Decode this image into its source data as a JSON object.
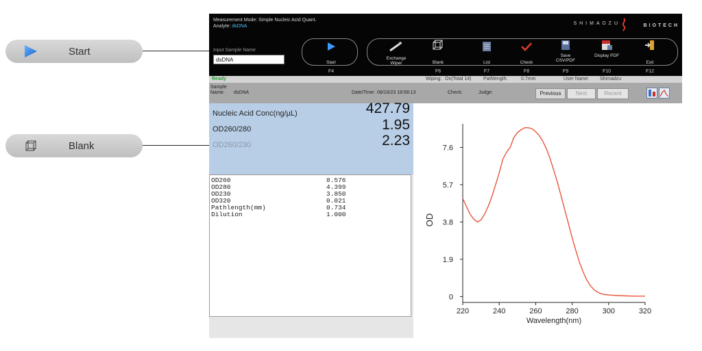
{
  "callouts": [
    {
      "label": "Start",
      "icon": "play-icon"
    },
    {
      "label": "Blank",
      "icon": "cube-outline-icon"
    }
  ],
  "header": {
    "mode_label": "Measurement Mode:",
    "mode_value": "Simple Nucleic Acid Quant.",
    "analyte_label": "Analyte:",
    "analyte_value": "dsDNA",
    "brand": "SHIMADZU",
    "brand_sub": "BIOTECH"
  },
  "sample_input": {
    "label": "Input Sample Name",
    "value": "dsDNA"
  },
  "toolbar": [
    {
      "label": "Start",
      "key": "F4",
      "icon": "play-icon"
    },
    {
      "label": "Exchange Wiper",
      "key": "",
      "icon": "wiper-icon"
    },
    {
      "label": "Blank",
      "key": "F6",
      "icon": "cube-outline-icon"
    },
    {
      "label": "List",
      "key": "F7",
      "icon": "list-icon"
    },
    {
      "label": "Check",
      "key": "F8",
      "icon": "checkmark-icon"
    },
    {
      "label": "Save CSV/PDF",
      "key": "F9",
      "icon": "save-icon"
    },
    {
      "label": "Display PDF",
      "key": "F10",
      "icon": "pdf-icon"
    },
    {
      "label": "Exit",
      "key": "F12",
      "icon": "exit-icon"
    }
  ],
  "status": {
    "state": "Ready",
    "wiping_label": "Wiping:",
    "wiping_value": "On(Total 14)",
    "pathlength_label": "Pathlength:",
    "pathlength_value": "0.7mm",
    "user_label": "User Name:",
    "user_value": "Shimadzu"
  },
  "info": {
    "sample_label": "Sample Name:",
    "sample_value": "dsDNA",
    "datetime_label": "Date/Time:",
    "datetime_value": "08/10/23 18:58:13",
    "check_label": "Check:",
    "judge_label": "Judge:",
    "previous": "Previous",
    "next": "Next",
    "recent": "Recent"
  },
  "results": [
    {
      "label": "Nucleic Acid Conc(ng/µL)",
      "value": "427.79"
    },
    {
      "label": "OD260/280",
      "value": "1.95"
    },
    {
      "label": "OD260/230",
      "value": "2.23"
    }
  ],
  "details": [
    {
      "label": "OD260",
      "value": "8.576"
    },
    {
      "label": "OD280",
      "value": "4.399"
    },
    {
      "label": "OD230",
      "value": "3.850"
    },
    {
      "label": "OD320",
      "value": "0.021"
    },
    {
      "label": "Pathlength(mm)",
      "value": "0.734"
    },
    {
      "label": "Dilution",
      "value": "1.000"
    }
  ],
  "colors": {
    "accent_red": "#e03a2a",
    "result_bg": "#b8cee6",
    "curve": "#e8553a"
  },
  "chart_data": {
    "type": "line",
    "xlabel": "Wavelength(nm)",
    "ylabel": "OD",
    "xlim": [
      220,
      320
    ],
    "ylim": [
      -0.3,
      8.8
    ],
    "xticks": [
      220,
      240,
      260,
      280,
      300,
      320
    ],
    "yticks": [
      "0",
      "1.9",
      "3.8",
      "5.7",
      "7.6"
    ],
    "ytick_values": [
      0,
      1.9,
      3.8,
      5.7,
      7.6
    ],
    "series": [
      {
        "x": [
          220,
          222,
          224,
          226,
          228,
          230,
          232,
          234,
          236,
          238,
          240,
          242,
          244,
          246,
          248,
          250,
          252,
          254,
          256,
          258,
          260,
          262,
          264,
          266,
          268,
          270,
          272,
          274,
          276,
          278,
          280,
          282,
          284,
          286,
          288,
          290,
          292,
          294,
          296,
          298,
          300,
          305,
          310,
          315,
          320
        ],
        "y": [
          5.0,
          4.6,
          4.2,
          3.95,
          3.8,
          3.9,
          4.2,
          4.6,
          5.1,
          5.7,
          6.3,
          7.0,
          7.35,
          7.6,
          8.1,
          8.35,
          8.5,
          8.6,
          8.6,
          8.55,
          8.4,
          8.2,
          7.9,
          7.5,
          7.0,
          6.4,
          5.8,
          5.1,
          4.4,
          3.7,
          3.0,
          2.35,
          1.75,
          1.25,
          0.85,
          0.55,
          0.35,
          0.22,
          0.14,
          0.1,
          0.08,
          0.05,
          0.03,
          0.02,
          0.02
        ]
      }
    ],
    "grid": false
  }
}
